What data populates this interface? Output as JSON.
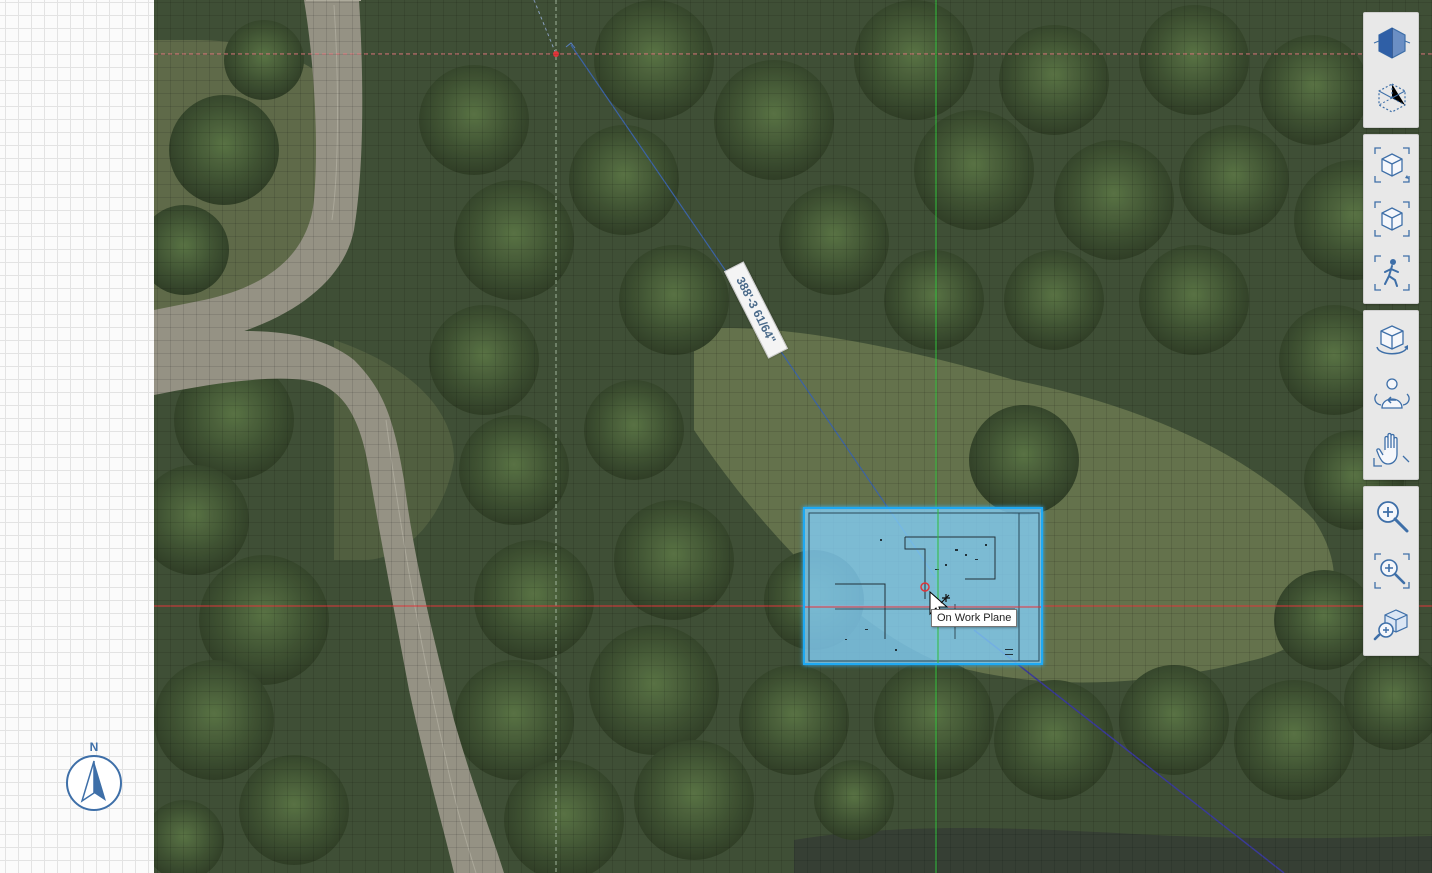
{
  "viewport": {
    "dimension_label": "388'-3 61/64\"",
    "snap_tooltip": "On Work Plane",
    "north_label": "N"
  },
  "toolbar": {
    "groups": [
      {
        "buttons": [
          {
            "icon": "view-cube-front-icon",
            "label": "Front view"
          },
          {
            "icon": "view-cube-iso-icon",
            "label": "Isometric view"
          }
        ]
      },
      {
        "buttons": [
          {
            "icon": "orbit-view-icon",
            "label": "Orbit view"
          },
          {
            "icon": "perspective-view-icon",
            "label": "Perspective view"
          },
          {
            "icon": "walk-through-icon",
            "label": "Walk through"
          }
        ]
      },
      {
        "buttons": [
          {
            "icon": "orbit-icon",
            "label": "Orbit"
          },
          {
            "icon": "look-around-icon",
            "label": "Look around"
          },
          {
            "icon": "pan-hand-icon",
            "label": "Pan"
          }
        ]
      },
      {
        "buttons": [
          {
            "icon": "zoom-icon",
            "label": "Zoom"
          },
          {
            "icon": "zoom-window-icon",
            "label": "Zoom window"
          },
          {
            "icon": "zoom-extents-icon",
            "label": "Zoom extents"
          }
        ]
      }
    ]
  },
  "colors": {
    "x_axis": "#e0353a",
    "y_axis": "#2fbf3a",
    "dimension_line": "#3c63a6",
    "selection": "#1ea9f3",
    "north_arrow": "#3e6fa8"
  }
}
